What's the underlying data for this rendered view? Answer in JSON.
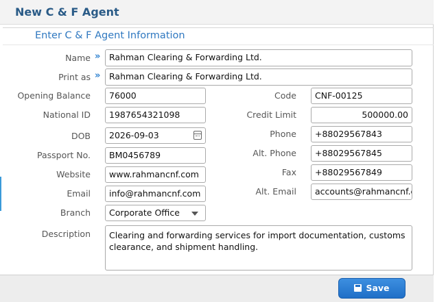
{
  "window": {
    "title": "New C & F Agent"
  },
  "section": {
    "title": "Enter C & F Agent Information"
  },
  "fields": {
    "name": {
      "label": "Name",
      "value": "Rahman Clearing & Forwarding Ltd."
    },
    "print_as": {
      "label": "Print as",
      "value": "Rahman Clearing & Forwarding Ltd."
    },
    "opening_balance": {
      "label": "Opening Balance",
      "value": "76000"
    },
    "code": {
      "label": "Code",
      "value": "CNF-00125"
    },
    "national_id": {
      "label": "National ID",
      "value": "1987654321098"
    },
    "credit_limit": {
      "label": "Credit Limit",
      "value": "500000.00"
    },
    "dob": {
      "label": "DOB",
      "value": "2026-09-03"
    },
    "phone": {
      "label": "Phone",
      "value": "+88029567843"
    },
    "passport": {
      "label": "Passport No.",
      "value": "BM0456789"
    },
    "alt_phone": {
      "label": "Alt. Phone",
      "value": "+88029567845"
    },
    "website": {
      "label": "Website",
      "value": "www.rahmancnf.com"
    },
    "fax": {
      "label": "Fax",
      "value": "+88029567849"
    },
    "email": {
      "label": "Email",
      "value": "info@rahmancnf.com"
    },
    "alt_email": {
      "label": "Alt. Email",
      "value": "accounts@rahmancnf.com"
    },
    "branch": {
      "label": "Branch",
      "value": "Corporate Office"
    },
    "description": {
      "label": "Description",
      "value": "Clearing and forwarding services for import documentation, customs clearance, and shipment handling."
    }
  },
  "footer": {
    "save_label": "Save"
  },
  "icons": {
    "expand": "double-chevron-right-icon",
    "calendar": "calendar-icon",
    "dropdown": "caret-down-icon",
    "save": "floppy-disk-icon"
  },
  "colors": {
    "title": "#2a5b87",
    "section": "#2f78c0",
    "accent": "#1f6fc7"
  }
}
